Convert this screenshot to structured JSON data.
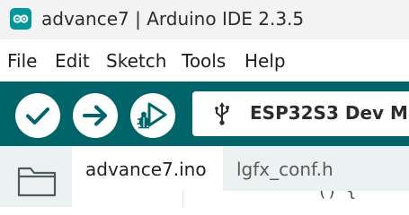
{
  "window": {
    "title": "advance7 | Arduino IDE 2.3.5",
    "icon": "arduino-logo-icon"
  },
  "menu": {
    "items": [
      {
        "label": "File"
      },
      {
        "label": "Edit"
      },
      {
        "label": "Sketch"
      },
      {
        "label": "Tools"
      },
      {
        "label": "Help"
      }
    ]
  },
  "toolbar": {
    "buttons": [
      {
        "name": "verify-button",
        "icon": "checkmark-icon"
      },
      {
        "name": "upload-button",
        "icon": "arrow-right-icon"
      },
      {
        "name": "debug-button",
        "icon": "debug-bug-icon"
      }
    ],
    "board_select": {
      "icon": "usb-icon",
      "label": "ESP32S3 Dev M"
    }
  },
  "sidebar": {
    "icon": "folder-icon"
  },
  "tabs": [
    {
      "label": "advance7.ino",
      "active": true
    },
    {
      "label": "lgfx_conf.h",
      "active": false
    }
  ],
  "editor": {
    "visible_code_fragment": "() {"
  },
  "colors": {
    "titlebar_bg": "#f3f3f3",
    "toolbar_bg": "#006468",
    "accent": "#00979c",
    "tab_strip_bg": "#ecf1f1"
  }
}
